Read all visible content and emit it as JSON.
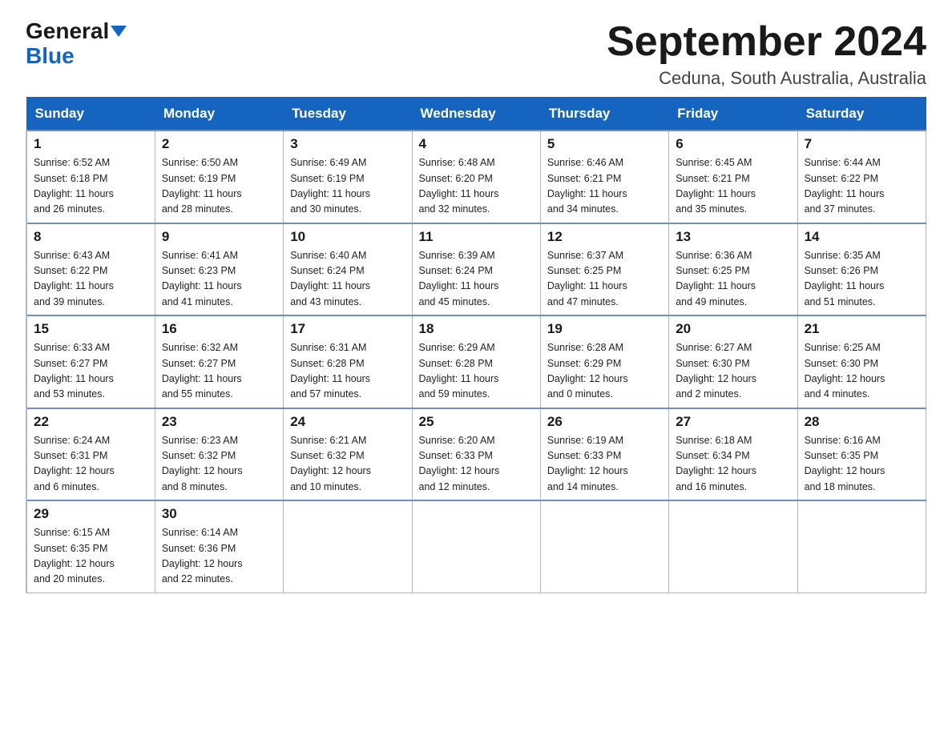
{
  "header": {
    "logo_general": "General",
    "logo_blue": "Blue",
    "month_title": "September 2024",
    "location": "Ceduna, South Australia, Australia"
  },
  "weekdays": [
    "Sunday",
    "Monday",
    "Tuesday",
    "Wednesday",
    "Thursday",
    "Friday",
    "Saturday"
  ],
  "weeks": [
    [
      {
        "day": "1",
        "sunrise": "6:52 AM",
        "sunset": "6:18 PM",
        "daylight": "11 hours and 26 minutes."
      },
      {
        "day": "2",
        "sunrise": "6:50 AM",
        "sunset": "6:19 PM",
        "daylight": "11 hours and 28 minutes."
      },
      {
        "day": "3",
        "sunrise": "6:49 AM",
        "sunset": "6:19 PM",
        "daylight": "11 hours and 30 minutes."
      },
      {
        "day": "4",
        "sunrise": "6:48 AM",
        "sunset": "6:20 PM",
        "daylight": "11 hours and 32 minutes."
      },
      {
        "day": "5",
        "sunrise": "6:46 AM",
        "sunset": "6:21 PM",
        "daylight": "11 hours and 34 minutes."
      },
      {
        "day": "6",
        "sunrise": "6:45 AM",
        "sunset": "6:21 PM",
        "daylight": "11 hours and 35 minutes."
      },
      {
        "day": "7",
        "sunrise": "6:44 AM",
        "sunset": "6:22 PM",
        "daylight": "11 hours and 37 minutes."
      }
    ],
    [
      {
        "day": "8",
        "sunrise": "6:43 AM",
        "sunset": "6:22 PM",
        "daylight": "11 hours and 39 minutes."
      },
      {
        "day": "9",
        "sunrise": "6:41 AM",
        "sunset": "6:23 PM",
        "daylight": "11 hours and 41 minutes."
      },
      {
        "day": "10",
        "sunrise": "6:40 AM",
        "sunset": "6:24 PM",
        "daylight": "11 hours and 43 minutes."
      },
      {
        "day": "11",
        "sunrise": "6:39 AM",
        "sunset": "6:24 PM",
        "daylight": "11 hours and 45 minutes."
      },
      {
        "day": "12",
        "sunrise": "6:37 AM",
        "sunset": "6:25 PM",
        "daylight": "11 hours and 47 minutes."
      },
      {
        "day": "13",
        "sunrise": "6:36 AM",
        "sunset": "6:25 PM",
        "daylight": "11 hours and 49 minutes."
      },
      {
        "day": "14",
        "sunrise": "6:35 AM",
        "sunset": "6:26 PM",
        "daylight": "11 hours and 51 minutes."
      }
    ],
    [
      {
        "day": "15",
        "sunrise": "6:33 AM",
        "sunset": "6:27 PM",
        "daylight": "11 hours and 53 minutes."
      },
      {
        "day": "16",
        "sunrise": "6:32 AM",
        "sunset": "6:27 PM",
        "daylight": "11 hours and 55 minutes."
      },
      {
        "day": "17",
        "sunrise": "6:31 AM",
        "sunset": "6:28 PM",
        "daylight": "11 hours and 57 minutes."
      },
      {
        "day": "18",
        "sunrise": "6:29 AM",
        "sunset": "6:28 PM",
        "daylight": "11 hours and 59 minutes."
      },
      {
        "day": "19",
        "sunrise": "6:28 AM",
        "sunset": "6:29 PM",
        "daylight": "12 hours and 0 minutes."
      },
      {
        "day": "20",
        "sunrise": "6:27 AM",
        "sunset": "6:30 PM",
        "daylight": "12 hours and 2 minutes."
      },
      {
        "day": "21",
        "sunrise": "6:25 AM",
        "sunset": "6:30 PM",
        "daylight": "12 hours and 4 minutes."
      }
    ],
    [
      {
        "day": "22",
        "sunrise": "6:24 AM",
        "sunset": "6:31 PM",
        "daylight": "12 hours and 6 minutes."
      },
      {
        "day": "23",
        "sunrise": "6:23 AM",
        "sunset": "6:32 PM",
        "daylight": "12 hours and 8 minutes."
      },
      {
        "day": "24",
        "sunrise": "6:21 AM",
        "sunset": "6:32 PM",
        "daylight": "12 hours and 10 minutes."
      },
      {
        "day": "25",
        "sunrise": "6:20 AM",
        "sunset": "6:33 PM",
        "daylight": "12 hours and 12 minutes."
      },
      {
        "day": "26",
        "sunrise": "6:19 AM",
        "sunset": "6:33 PM",
        "daylight": "12 hours and 14 minutes."
      },
      {
        "day": "27",
        "sunrise": "6:18 AM",
        "sunset": "6:34 PM",
        "daylight": "12 hours and 16 minutes."
      },
      {
        "day": "28",
        "sunrise": "6:16 AM",
        "sunset": "6:35 PM",
        "daylight": "12 hours and 18 minutes."
      }
    ],
    [
      {
        "day": "29",
        "sunrise": "6:15 AM",
        "sunset": "6:35 PM",
        "daylight": "12 hours and 20 minutes."
      },
      {
        "day": "30",
        "sunrise": "6:14 AM",
        "sunset": "6:36 PM",
        "daylight": "12 hours and 22 minutes."
      },
      null,
      null,
      null,
      null,
      null
    ]
  ],
  "labels": {
    "sunrise": "Sunrise:",
    "sunset": "Sunset:",
    "daylight": "Daylight:"
  }
}
